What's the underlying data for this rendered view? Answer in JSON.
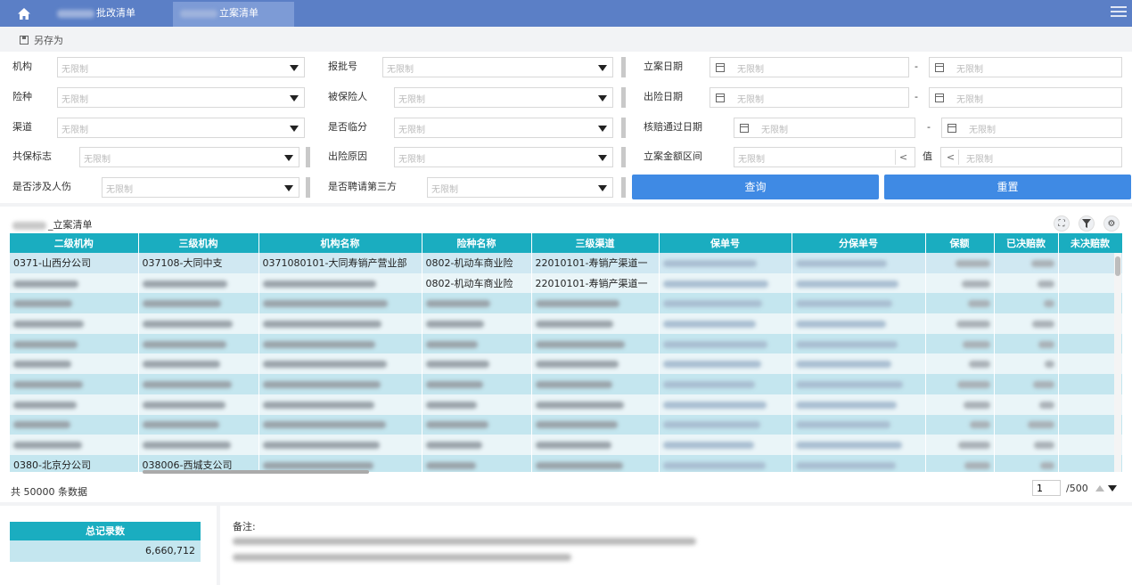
{
  "header": {
    "tabs": [
      {
        "label": "批改清单"
      },
      {
        "label": "立案清单"
      }
    ]
  },
  "toolbar": {
    "save_as_label": "另存为"
  },
  "filters": {
    "placeholder": "无限制",
    "fields": {
      "org": "机构",
      "insurance_type": "险种",
      "channel": "渠道",
      "coinsurance_flag": "共保标志",
      "involves_injury": "是否涉及人伤",
      "endorsement_no": "报批号",
      "insured": "被保险人",
      "temp_reinsurance": "是否临分",
      "accident_cause": "出险原因",
      "hire_third_party": "是否聘请第三方",
      "filing_date": "立案日期",
      "accident_date": "出险日期",
      "approval_date": "核赔通过日期",
      "filing_amount_range": "立案金额区间",
      "value_label": "值"
    },
    "range_dash": "-",
    "lt_symbol": "<",
    "query_button": "查询",
    "reset_button": "重置"
  },
  "grid": {
    "title_suffix": "_立案清单",
    "columns": [
      "二级机构",
      "三级机构",
      "机构名称",
      "险种名称",
      "三级渠道",
      "保单号",
      "分保单号",
      "保额",
      "已决赔款",
      "未决赔款"
    ],
    "rows": [
      {
        "c1": "0371-山西分公司",
        "c2": "037108-大同中支",
        "c3": "0371080101-大同寿销产营业部",
        "c4": "0802-机动车商业险",
        "c5": "22010101-寿销产渠道一"
      },
      {
        "c1": "",
        "c2": "",
        "c3": "",
        "c4": "0802-机动车商业险",
        "c5": "22010101-寿销产渠道一"
      },
      {
        "c1": "",
        "c2": "",
        "c3": "",
        "c4": "",
        "c5": ""
      },
      {
        "c1": "",
        "c2": "",
        "c3": "",
        "c4": "",
        "c5": ""
      },
      {
        "c1": "",
        "c2": "",
        "c3": "",
        "c4": "",
        "c5": ""
      },
      {
        "c1": "",
        "c2": "",
        "c3": "",
        "c4": "",
        "c5": ""
      },
      {
        "c1": "",
        "c2": "",
        "c3": "",
        "c4": "",
        "c5": ""
      },
      {
        "c1": "",
        "c2": "",
        "c3": "",
        "c4": "",
        "c5": ""
      },
      {
        "c1": "",
        "c2": "",
        "c3": "",
        "c4": "",
        "c5": ""
      },
      {
        "c1": "",
        "c2": "",
        "c3": "",
        "c4": "",
        "c5": ""
      },
      {
        "c1": "0380-北京分公司",
        "c2": "038006-西城支公司",
        "c3": "",
        "c4": "",
        "c5": ""
      }
    ]
  },
  "pagination": {
    "total_text": "共  50000  条数据",
    "current_page": "1",
    "total_pages": "/500"
  },
  "summary": {
    "header": "总记录数",
    "value": "6,660,712"
  },
  "remark": {
    "label": "备注:"
  }
}
